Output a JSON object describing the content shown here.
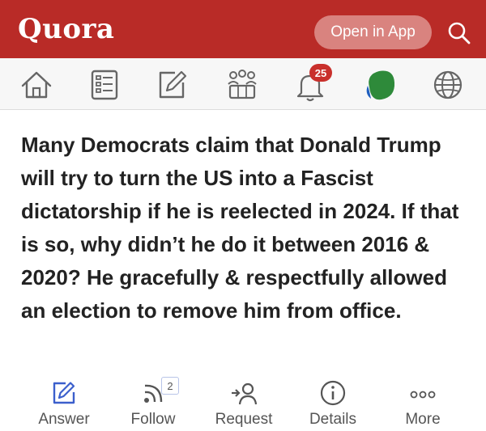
{
  "header": {
    "logo": "Quora",
    "open_app_label": "Open in App",
    "search_icon": "search-icon"
  },
  "nav": {
    "items": [
      {
        "icon": "home-icon"
      },
      {
        "icon": "answers-list-icon"
      },
      {
        "icon": "write-icon"
      },
      {
        "icon": "spaces-icon"
      },
      {
        "icon": "bell-icon",
        "badge": "25"
      },
      {
        "icon": "profile-avatar-icon",
        "color": "#2e8a3a"
      },
      {
        "icon": "globe-icon"
      }
    ]
  },
  "question": {
    "text": "Many Democrats claim that Donald Trump will try to turn the US into a Fascist dictatorship if he is reelected in 2024. If that is so, why didn’t he do it between 2016 & 2020? He gracefully & respectfully allowed an election to remove him from office."
  },
  "actions": {
    "answer_label": "Answer",
    "follow_label": "Follow",
    "follow_count": "2",
    "request_label": "Request",
    "details_label": "Details",
    "more_label": "More"
  },
  "colors": {
    "brand_red": "#b92b27",
    "accent_blue": "#3b5fcc"
  }
}
